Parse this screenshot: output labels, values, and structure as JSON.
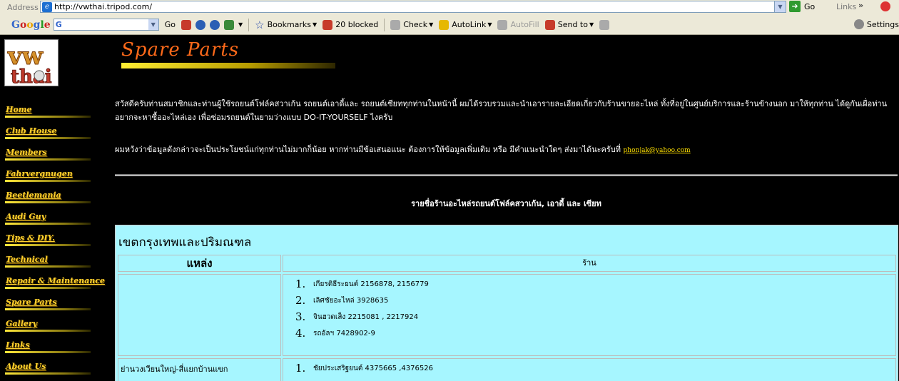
{
  "browser": {
    "address_label": "Address",
    "url": "http://vwthai.tripod.com/",
    "go_label": "Go",
    "links_label": "Links",
    "links_chevron": "»",
    "toolbar": {
      "google_logo": "Google",
      "search_prefix": "G",
      "go": "Go",
      "bookmarks": "Bookmarks",
      "blocked": "20 blocked",
      "check": "Check",
      "autolink": "AutoLink",
      "autofill": "AutoFill",
      "send_to": "Send to",
      "settings": "Settings"
    }
  },
  "site": {
    "logo_text_top": "vw",
    "logo_text_bottom": "thai",
    "title": "Spare Parts",
    "nav": [
      "Home",
      "Club House",
      "Members",
      "Fahrvergnugen",
      "Beetlemania",
      "Audi Guy",
      "Tips & DIY.",
      "Technical",
      "Repair & Maintenance",
      "Spare Parts",
      "Gallery",
      "Links",
      "About Us"
    ],
    "intro_1": "สวัสดีครับท่านสมาชิกและท่านผู้ใช้รถยนต์โฟล์คสวาเก้น รถยนต์เอาดี้และ รถยนต์เซียททุกท่านในหน้านี้ ผมได้รวบรวมและนำเอารายละเอียดเกี่ยวกับร้านขายอะไหล่ ทั้งที่อยู่ในศูนย์บริการและร้านข้างนอก มาให้ทุกท่าน ได้ดูกันเผื่อท่านอยากจะหาซื้ออะไหล่เอง เพื่อซ่อมรถยนต์ในยามว่างแบบ DO-IT-YOURSELF ไงครับ",
    "intro_2_prefix": "ผมหวังว่าข้อมูลดังกล่าวจะเป็นประโยชน์แก่ทุกท่านไม่มากก็น้อย หากท่านมีข้อเสนอแนะ ต้องการให้ข้อมูลเพิ่มเติม หรือ มีคำแนะนำใดๆ ส่งมาได้นะครับที่",
    "email": "phonjak@yahoo.com",
    "list_title": "รายชื่อร้านอะไหล่รถยนต์โฟล์คสวาเก้น, เอาดี้ และ เซียท",
    "table": {
      "region": "เขตกรุงเทพและปริมณฑล",
      "col_location": "แหล่ง",
      "col_shop": "ร้าน",
      "rows": [
        {
          "location": "",
          "shops": [
            {
              "num": "1.",
              "text": "เกียรติธีระยนต์ 2156878, 2156779"
            },
            {
              "num": "2.",
              "text": "เลิศชัยอะไหล่ 3928635"
            },
            {
              "num": "3.",
              "text": "จินฮวดเส็ง 2215081 , 2217924"
            },
            {
              "num": "4.",
              "text": "รถอัลฯ 7428902-9"
            }
          ]
        },
        {
          "location": "ย่านวงเวียนใหญ่-สี่แยกบ้านแขก",
          "shops": [
            {
              "num": "1.",
              "text": "ชัยประเสริฐยนต์ 4375665 ,4376526"
            }
          ]
        }
      ]
    }
  }
}
